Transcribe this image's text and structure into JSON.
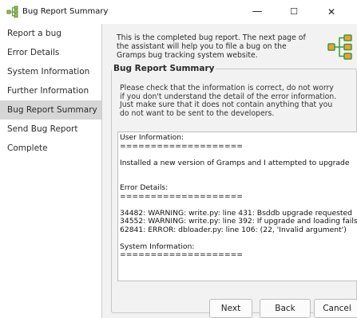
{
  "window": {
    "title": "Bug Report Summary",
    "minimize_glyph": "—",
    "maximize_glyph": "☐",
    "close_glyph": "✕"
  },
  "sidebar": {
    "items": [
      {
        "label": "Report a bug"
      },
      {
        "label": "Error Details"
      },
      {
        "label": "System Information"
      },
      {
        "label": "Further Information"
      },
      {
        "label": "Bug Report Summary",
        "active": true
      },
      {
        "label": "Send Bug Report"
      },
      {
        "label": "Complete"
      }
    ]
  },
  "main": {
    "intro": "This is the completed bug report. The next page of the assistant will help you to file a bug on the Gramps bug tracking system website.",
    "section_title": "Bug Report Summary",
    "instructions": "Please check that the information is correct, do not worry if you don't understand the detail of the error information. Just make sure that it does not contain anything that you do not want to be sent to the developers.",
    "report_text": "User Information:\n====================\n\nInstalled a new version of Gramps and I attempted to upgrade\n\n\nError Details:\n====================\n\n34482: WARNING: write.py: line 431: Bsddb upgrade requested\n34552: WARNING: write.py: line 392: If upgrade and loading fails\n62841: ERROR: dbloader.py: line 106: (22, 'Invalid argument')\n\nSystem Information:\n===================="
  },
  "buttons": {
    "next": "Next",
    "back": "Back",
    "cancel": "Cancel"
  },
  "colors": {
    "active_item_bg": "#d6d6d6",
    "panel_bg": "#f2f2f2",
    "logo_orange": "#f0a030",
    "logo_green": "#3a9a3a"
  }
}
